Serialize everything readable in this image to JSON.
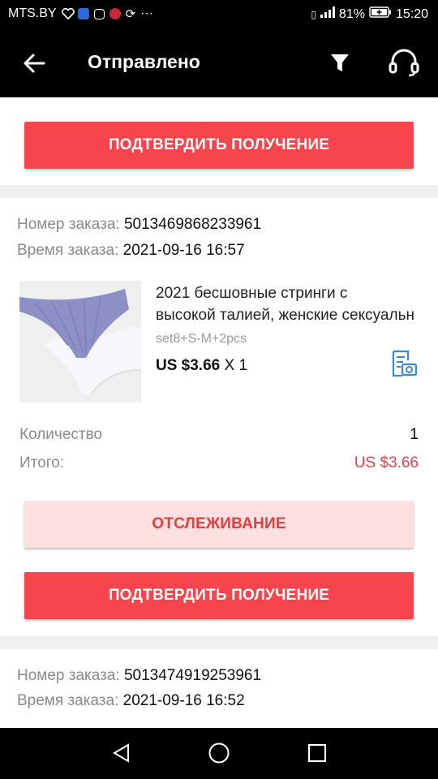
{
  "status_bar": {
    "carrier": "MTS.BY",
    "battery": "81%",
    "time": "15:20"
  },
  "header": {
    "title": "Отправлено"
  },
  "buttons": {
    "confirm": "ПОДТВЕРДИТЬ ПОЛУЧЕНИЕ",
    "track": "ОТСЛЕЖИВАНИЕ"
  },
  "orders": [
    {
      "order_number_label": "Номер заказа:",
      "order_number": "5013469868233961",
      "order_time_label": "Время заказа:",
      "order_time": "2021-09-16 16:57",
      "product": {
        "title_line1": "2021 бесшовные стринги с",
        "title_line2": "высокой талией, женские сексуальн",
        "sku": "set8+S-M+2pcs",
        "price": "US $3.66",
        "qty": "X 1"
      },
      "quantity_label": "Количество",
      "quantity": "1",
      "total_label": "Итого:",
      "total": "US $3.66"
    },
    {
      "order_number_label": "Номер заказа:",
      "order_number": "5013474919253961",
      "order_time_label": "Время заказа:",
      "order_time": "2021-09-16 16:52"
    }
  ],
  "colors": {
    "primary": "#f6454d",
    "secondary_bg": "#fde0df",
    "price_red": "#e8414a"
  }
}
